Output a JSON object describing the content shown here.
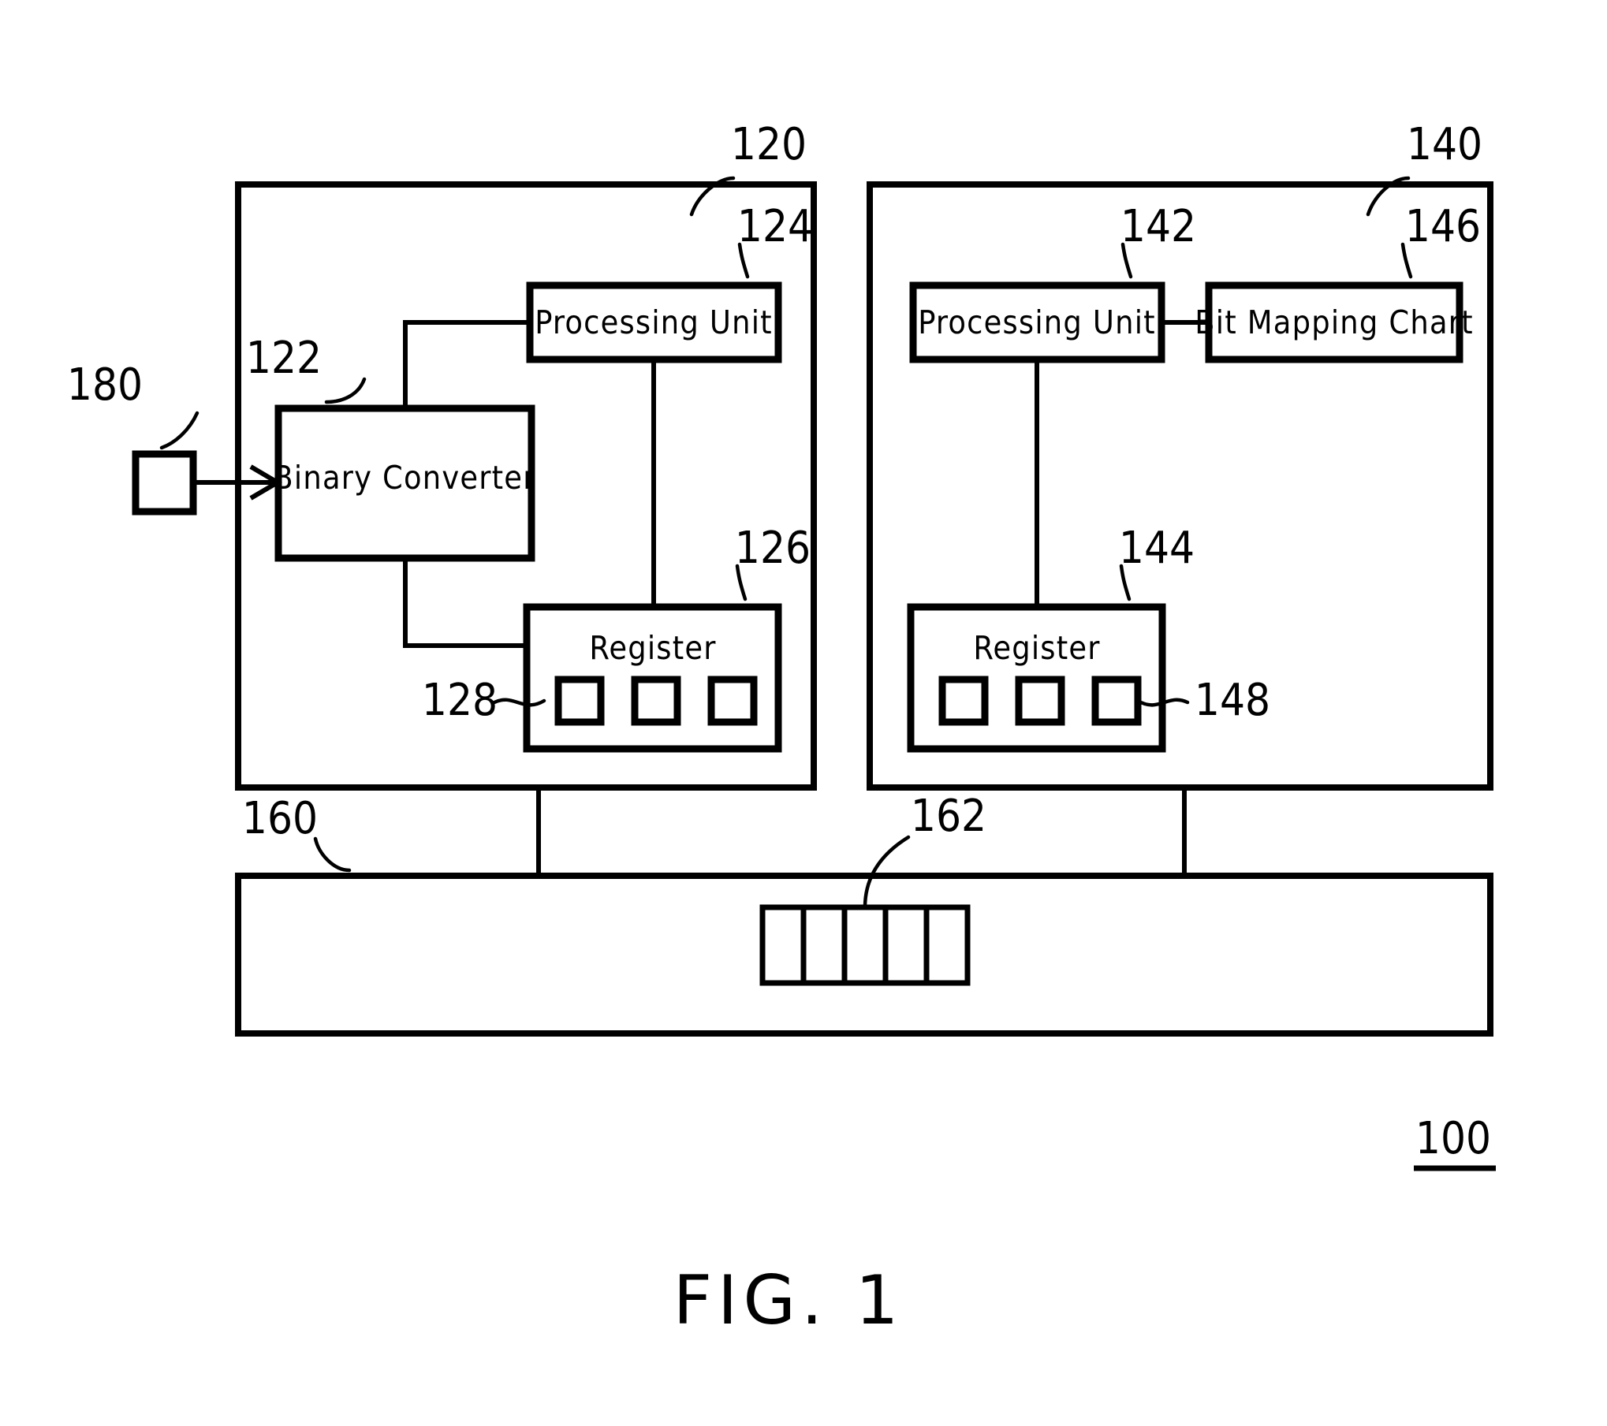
{
  "figure": {
    "caption": "FIG. 1",
    "system_ref": "100"
  },
  "blocks": {
    "first_device": {
      "ref": "120",
      "children": {
        "binary_converter": {
          "ref": "122",
          "label": "Binary Converter"
        },
        "processing_unit": {
          "ref": "124",
          "label": "Processing Unit"
        },
        "register": {
          "ref": "126",
          "label": "Register"
        },
        "register_bits": {
          "ref": "128",
          "count": 3
        }
      }
    },
    "second_device": {
      "ref": "140",
      "children": {
        "processing_unit": {
          "ref": "142",
          "label": "Processing Unit"
        },
        "register": {
          "ref": "144",
          "label": "Register"
        },
        "bit_mapping_chart": {
          "ref": "146",
          "label": "Bit Mapping Chart"
        },
        "register_bits": {
          "ref": "148",
          "count": 3
        }
      }
    },
    "input_source": {
      "ref": "180"
    },
    "bus": {
      "ref": "160",
      "packet": {
        "ref": "162",
        "cells": 5
      }
    }
  },
  "colors": {
    "stroke": "#000000",
    "background": "#ffffff"
  }
}
